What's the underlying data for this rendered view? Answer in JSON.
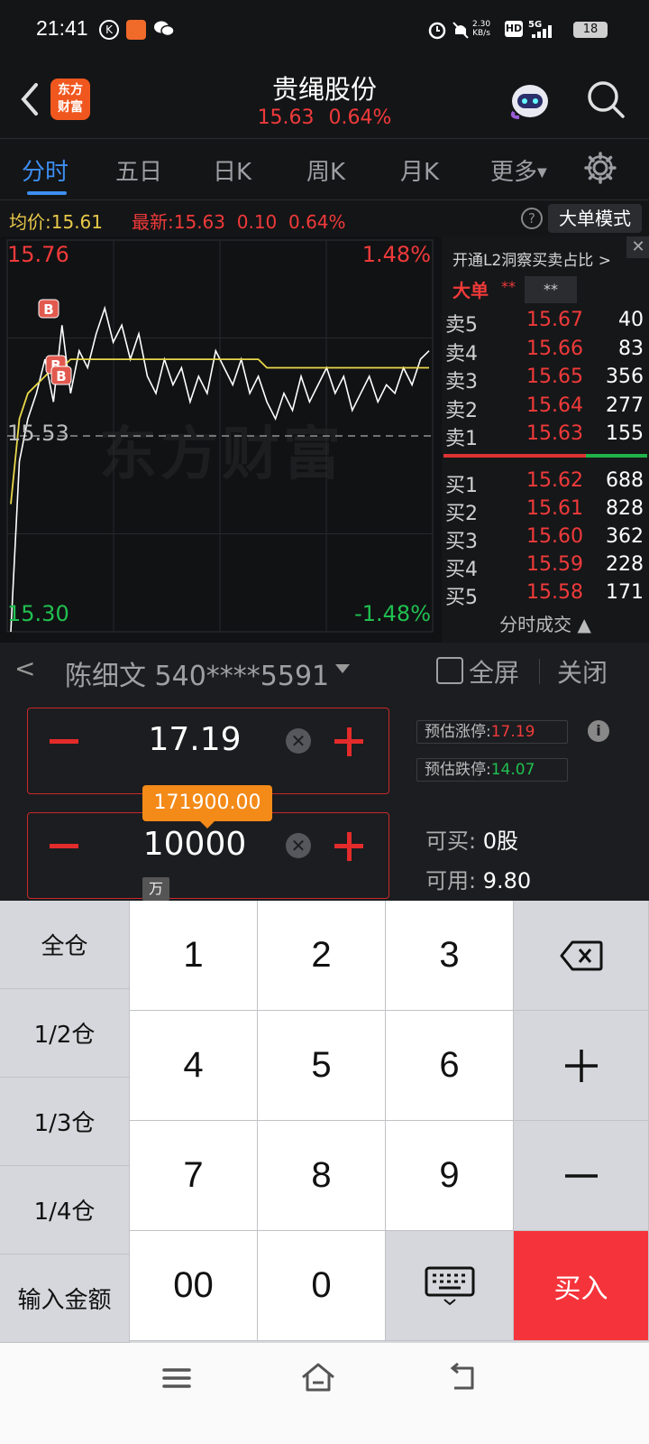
{
  "status_bar": {
    "time": "21:41",
    "net_speed_value": "2.30",
    "net_speed_unit": "KB/s",
    "battery": "18",
    "icons": [
      "k-icon",
      "app-icon",
      "wechat-icon",
      "alarm-icon",
      "mute-icon",
      "hd-icon",
      "signal-5g-icon"
    ]
  },
  "header": {
    "logo_line1": "东方",
    "logo_line2": "财富",
    "stock_name": "贵绳股份",
    "price": "15.63",
    "change_pct": "0.64%"
  },
  "tabs": [
    "分时",
    "五日",
    "日K",
    "周K",
    "月K",
    "更多"
  ],
  "info_line": {
    "avg_label": "均价:",
    "avg_value": "15.61",
    "latest_label": "最新:",
    "latest_value": "15.63",
    "change": "0.10",
    "change_pct": "0.64%",
    "mode_button": "大单模式"
  },
  "chart": {
    "y_max_label": "15.76",
    "y_mid_label": "15.53",
    "y_min_label": "15.30",
    "pct_max_label": "1.48%",
    "pct_min_label": "-1.48%",
    "watermark": "东方财富",
    "colors": {
      "price": "#ffffff",
      "avg": "#e8d84a",
      "up": "#f03a3a",
      "down": "#20c050"
    }
  },
  "chart_data": {
    "type": "line",
    "y_range": [
      15.3,
      15.76
    ],
    "prev_close": 15.53,
    "series": [
      {
        "values": [
          15.3,
          15.5,
          15.55,
          15.58,
          15.62,
          15.57,
          15.66,
          15.58,
          15.63,
          15.61,
          15.65,
          15.68,
          15.64,
          15.66,
          15.62,
          15.65,
          15.6,
          15.58,
          15.62,
          15.59,
          15.61,
          15.57,
          15.6,
          15.58,
          15.63,
          15.61,
          15.59,
          15.62,
          15.58,
          15.6,
          15.57,
          15.55,
          15.58,
          15.56,
          15.6,
          15.57,
          15.59,
          15.61,
          15.58,
          15.6,
          15.56,
          15.58,
          15.6,
          15.57,
          15.59,
          15.58,
          15.61,
          15.59,
          15.62,
          15.63
        ]
      },
      {
        "values": [
          15.45,
          15.55,
          15.58,
          15.59,
          15.6,
          15.61,
          15.61,
          15.62,
          15.62,
          15.62,
          15.62,
          15.62,
          15.62,
          15.62,
          15.62,
          15.62,
          15.62,
          15.62,
          15.62,
          15.62,
          15.62,
          15.62,
          15.62,
          15.62,
          15.62,
          15.62,
          15.62,
          15.62,
          15.62,
          15.62,
          15.61,
          15.61,
          15.61,
          15.61,
          15.61,
          15.61,
          15.61,
          15.61,
          15.61,
          15.61,
          15.61,
          15.61,
          15.61,
          15.61,
          15.61,
          15.61,
          15.61,
          15.61,
          15.61,
          15.61
        ]
      }
    ],
    "markers": [
      "B",
      "B",
      "B"
    ]
  },
  "orderbook": {
    "promo": "开通L2洞察买卖占比 >",
    "big_order": "大单",
    "stars": "**",
    "sell": [
      {
        "label": "卖5",
        "price": "15.67",
        "vol": "40"
      },
      {
        "label": "卖4",
        "price": "15.66",
        "vol": "83"
      },
      {
        "label": "卖3",
        "price": "15.65",
        "vol": "356"
      },
      {
        "label": "卖2",
        "price": "15.64",
        "vol": "277"
      },
      {
        "label": "卖1",
        "price": "15.63",
        "vol": "155"
      }
    ],
    "buy": [
      {
        "label": "买1",
        "price": "15.62",
        "vol": "688"
      },
      {
        "label": "买2",
        "price": "15.61",
        "vol": "828"
      },
      {
        "label": "买3",
        "price": "15.60",
        "vol": "362"
      },
      {
        "label": "买4",
        "price": "15.59",
        "vol": "228"
      },
      {
        "label": "买5",
        "price": "15.58",
        "vol": "171"
      }
    ],
    "footer": "分时成交 ▲"
  },
  "trade": {
    "account": "陈细文 540****5591",
    "fullscreen": "全屏",
    "close": "关闭",
    "price": "17.19",
    "quantity": "10000",
    "amount_tip": "171900.00",
    "unit": "万",
    "limit_up_label": "预估涨停:",
    "limit_up_value": "17.19",
    "limit_down_label": "预估跌停:",
    "limit_down_value": "14.07",
    "can_buy_label": "可买:",
    "can_buy_value": "0股",
    "available_label": "可用:",
    "available_value": "9.80"
  },
  "keypad": {
    "left": [
      "全仓",
      "1/2仓",
      "1/3仓",
      "1/4仓",
      "输入金额"
    ],
    "digits": [
      "1",
      "2",
      "3",
      "4",
      "5",
      "6",
      "7",
      "8",
      "9",
      "00",
      "0"
    ],
    "buy": "买入"
  }
}
